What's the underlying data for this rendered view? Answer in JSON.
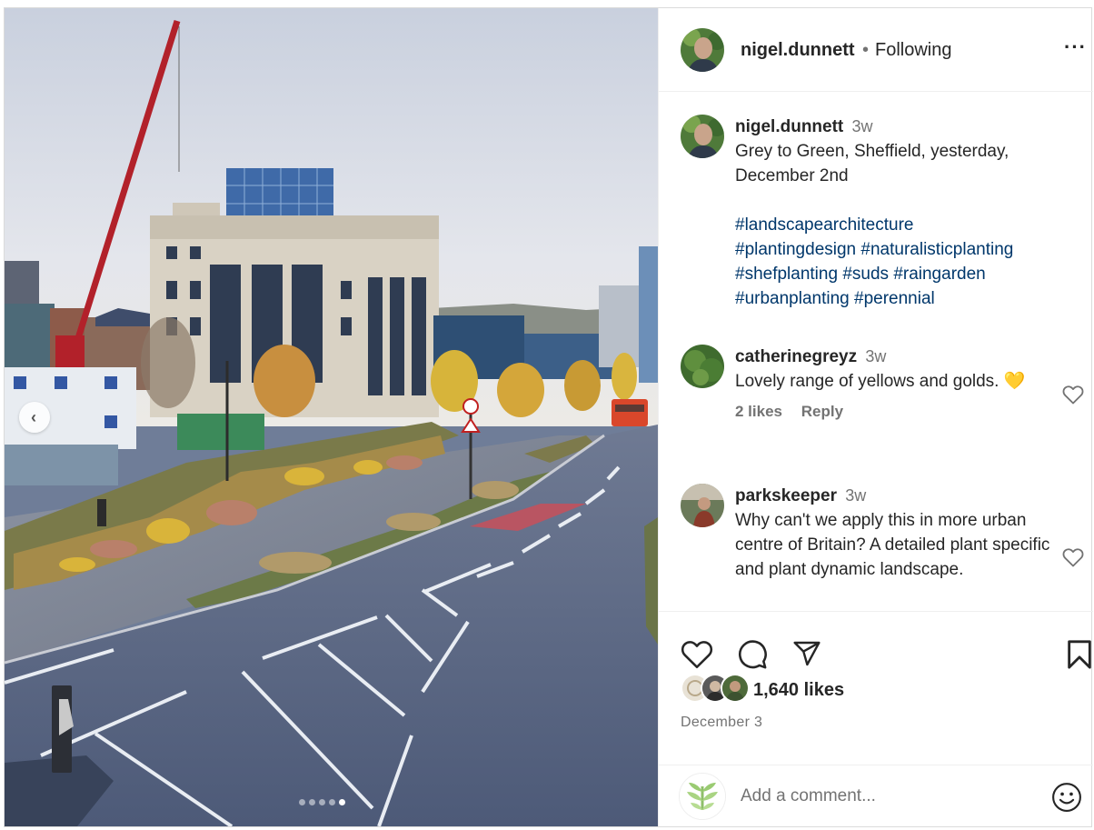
{
  "post": {
    "author": "nigel.dunnett",
    "separator": "•",
    "follow_status": "Following",
    "more_glyph": "···"
  },
  "carousel": {
    "prev_glyph": "‹",
    "slide_count": 5,
    "active_slide": 5
  },
  "caption": {
    "username": "nigel.dunnett",
    "time": "3w",
    "text": "Grey to Green, Sheffield, yesterday, December 2nd",
    "hashtags": [
      "#landscapearchitecture",
      "#plantingdesign",
      "#naturalisticplanting",
      "#shefplanting",
      "#suds",
      "#raingarden",
      "#urbanplanting",
      "#perennial"
    ]
  },
  "comments": [
    {
      "username": "catherinegreyz",
      "time": "3w",
      "text": "Lovely range of yellows and golds. 💛",
      "likes": "2 likes",
      "reply": "Reply"
    },
    {
      "username": "parkskeeper",
      "time": "3w",
      "text": "Why can't we apply this in more urban centre of Britain? A detailed plant specific and plant dynamic landscape."
    }
  ],
  "engagement": {
    "likes": "1,640 likes",
    "date": "December 3"
  },
  "composer": {
    "placeholder": "Add a comment..."
  },
  "icons": {
    "like": "heart-icon",
    "comment": "comment-bubble-icon",
    "share": "paper-plane-icon",
    "save": "bookmark-icon",
    "emoji": "smiley-icon",
    "more": "more-options-icon",
    "prev": "chevron-left-icon"
  }
}
